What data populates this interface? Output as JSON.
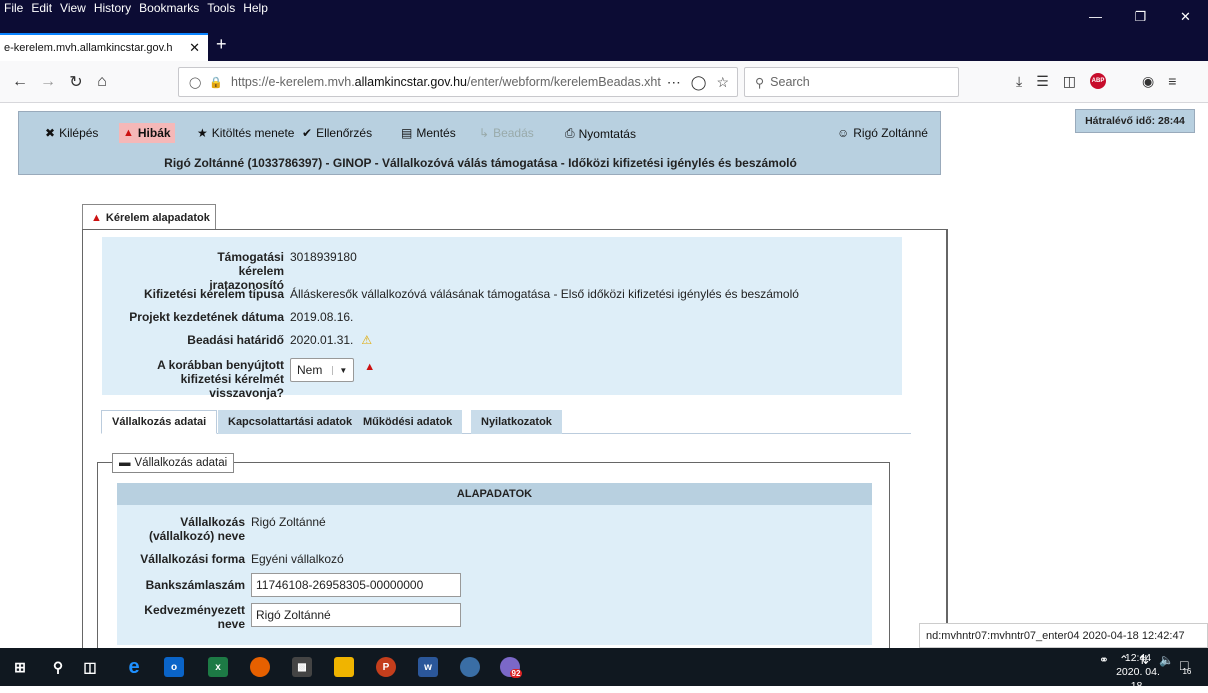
{
  "browser": {
    "menu": [
      "File",
      "Edit",
      "View",
      "History",
      "Bookmarks",
      "Tools",
      "Help"
    ],
    "tab_title": "e-kerelem.mvh.allamkincstar.gov.h",
    "url_prefix": "https://e-kerelem.mvh.",
    "url_host": "allamkincstar.gov.hu",
    "url_path": "/enter/webform/kerelemBeadas.xht",
    "search_placeholder": "Search"
  },
  "toolbar": {
    "kilepes": "Kilépés",
    "hibak": "Hibák",
    "kitoltes": "Kitöltés menete",
    "ellenorzes": "Ellenőrzés",
    "mentes": "Mentés",
    "beadas": "Beadás",
    "nyomtatas": "Nyomtatás",
    "user": "Rigó Zoltánné",
    "title": "Rigó Zoltánné (1033786397) - GINOP - Vállalkozóvá válás támogatása - Időközi kifizetési igénylés és beszámoló",
    "timer": "Hátralévő idő: 28:44"
  },
  "main_tab": "Kérelem alapadatok",
  "info": {
    "r1_label": "Támogatási kérelem iratazonosító",
    "r1_value": "3018939180",
    "r2_label": "Kifizetési kérelem típusa",
    "r2_value": "Álláskeresők vállalkozóvá válásának támogatása - Első időközi kifizetési igénylés és beszámoló",
    "r3_label": "Projekt kezdetének dátuma",
    "r3_value": "2019.08.16.",
    "r4_label": "Beadási határidő",
    "r4_value": "2020.01.31.",
    "r5_label": "A korábban benyújtott kifizetési kérelmét visszavonja?",
    "r5_value": "Nem"
  },
  "subtabs": [
    "Vállalkozás adatai",
    "Kapcsolattartási adatok",
    "Működési adatok",
    "Nyilatkozatok"
  ],
  "section": {
    "legend": "Vállalkozás adatai",
    "header": "ALAPADATOK",
    "f1_label": "Vállalkozás (vállalkozó) neve",
    "f1_value": "Rigó Zoltánné",
    "f2_label": "Vállalkozási forma",
    "f2_value": "Egyéni vállalkozó",
    "f3_label": "Bankszámlaszám",
    "f3_value": "11746108-26958305-00000000",
    "f4_label": "Kedvezményezett neve",
    "f4_value": "Rigó Zoltánné"
  },
  "status": "nd:mvhntr07:mvhntr07_enter04   2020-04-18 12:42:47",
  "taskbar": {
    "time": "12:44",
    "date": "2020. 04. 18.",
    "notif_count": "16",
    "badge": "92"
  },
  "colors": {
    "panel": "#b8d0e0",
    "info_bg": "#deeef8",
    "hibak_bg": "#f5b8b8",
    "titlebar": "#0c0c34"
  }
}
